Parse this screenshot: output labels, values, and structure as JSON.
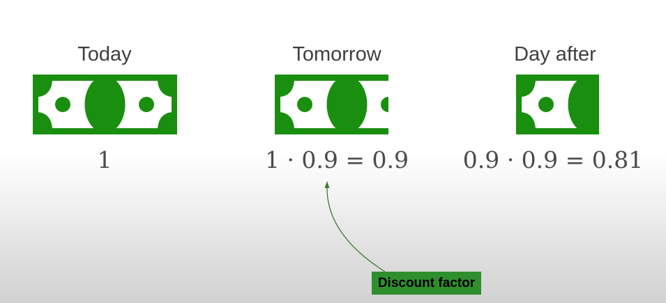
{
  "columns": [
    {
      "heading": "Today",
      "formula": "1"
    },
    {
      "heading": "Tomorrow",
      "formula": "1 · 0.9 = 0.9"
    },
    {
      "heading": "Day after",
      "formula": "0.9 · 0.9 = 0.81"
    }
  ],
  "annotation": {
    "label": "Discount factor"
  },
  "colors": {
    "bill_green": "#1a8f0f",
    "label_green": "#2f8f2f",
    "arrow": "#3d7a2f"
  },
  "bill_fraction_shown": [
    1.0,
    0.81,
    0.57
  ]
}
